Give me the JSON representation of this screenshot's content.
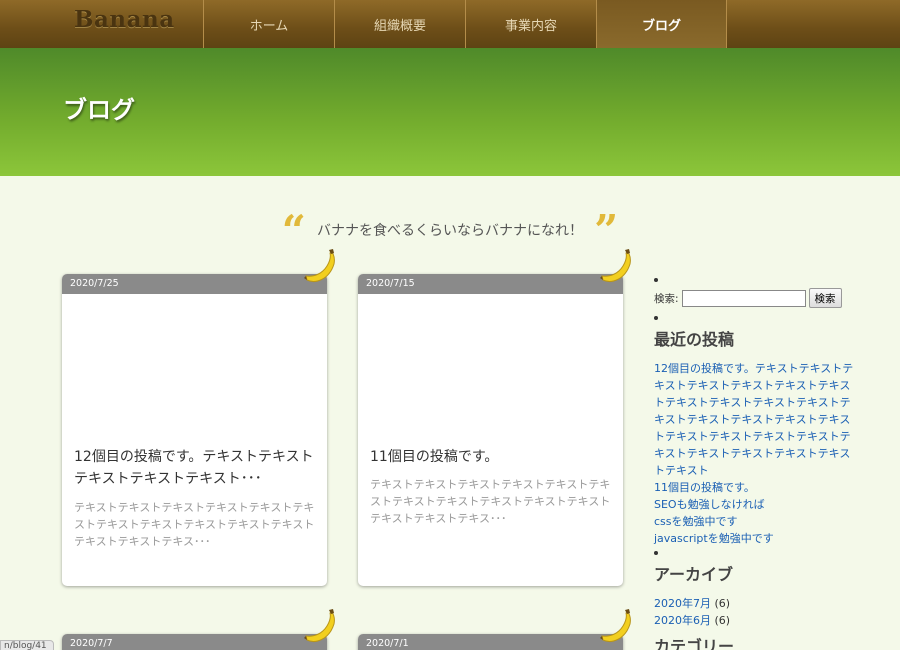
{
  "site": {
    "logo": "Banana"
  },
  "nav": {
    "items": [
      "ホーム",
      "組織概要",
      "事業内容",
      "ブログ"
    ],
    "active_index": 3
  },
  "hero": {
    "title": "ブログ"
  },
  "tagline": {
    "open_quote": "“",
    "text": "バナナを食べるくらいならバナナになれ！",
    "close_quote": "”"
  },
  "posts": [
    {
      "date": "2020/7/25",
      "title": "12個目の投稿です。テキストテキストテキストテキストテキスト･･･",
      "excerpt": "テキストテキストテキストテキストテキストテキストテキストテキストテキストテキストテキストテキストテキストテキス･･･"
    },
    {
      "date": "2020/7/15",
      "title": "11個目の投稿です。",
      "excerpt": "テキストテキストテキストテキストテキストテキストテキストテキストテキストテキストテキストテキストテキストテキス･･･"
    },
    {
      "date": "2020/7/7"
    },
    {
      "date": "2020/7/1"
    }
  ],
  "sidebar": {
    "search": {
      "label": "検索:",
      "value": "",
      "button": "検索"
    },
    "recent_title": "最近の投稿",
    "recent_posts": [
      "12個目の投稿です。テキストテキストテキストテキストテキストテキストテキストテキストテキストテキストテキストテキストテキストテキストテキストテキストテキストテキストテキストテキストテキストテキストテキストテキストテキストテキスト",
      "11個目の投稿です。",
      "SEOも勉強しなければ",
      "cssを勉強中です",
      "javascriptを勉強中です"
    ],
    "archive_title": "アーカイブ",
    "archives": [
      {
        "label": "2020年7月",
        "count": "(6)"
      },
      {
        "label": "2020年6月",
        "count": "(6)"
      }
    ],
    "category_title": "カテゴリー"
  },
  "status_url": "n/blog/41",
  "colors": {
    "header": "#7a5a21",
    "hero": "#72ab2d",
    "link": "#1a5fb4",
    "banana": "#f2cf1f"
  }
}
